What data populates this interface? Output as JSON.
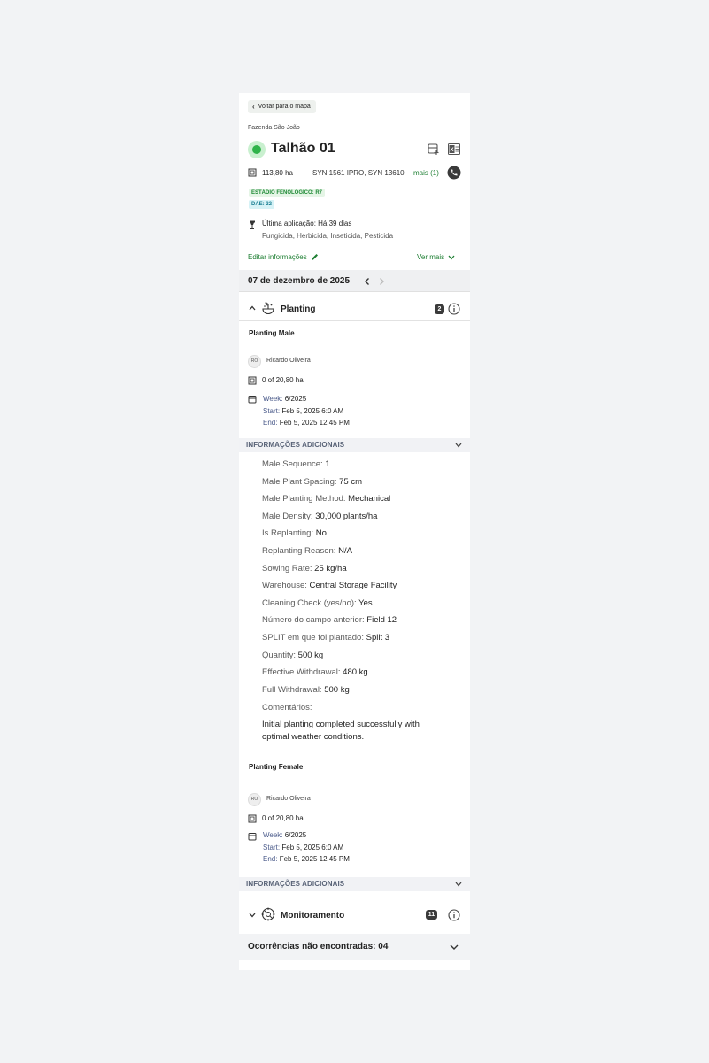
{
  "header": {
    "back_label": "Voltar para o mapa",
    "farm_name": "Fazenda São João",
    "field_name": "Talhão 01",
    "area": "113,80 ha",
    "varieties": "SYN 1561 IPRO, SYN 13610",
    "more_link": "mais (1)",
    "phenology_badge": "ESTÁDIO FENOLÓGICO: R7",
    "dae_badge": "DAE: 32",
    "last_application": "Última aplicação: Há 39 dias",
    "application_types": "Fungicida, Herbicida, Inseticida, Pesticida",
    "edit_link": "Editar informações",
    "see_more_link": "Ver mais"
  },
  "date_bar": {
    "date": "07 de dezembro de 2025"
  },
  "planting": {
    "title": "Planting",
    "count": "2",
    "male": {
      "title": "Planting Male",
      "avatar_initials": "RO",
      "person": "Ricardo Oliveira",
      "area": "0 of 20,80 ha",
      "week_label": "Week:",
      "week_value": "6/2025",
      "start_label": "Start:",
      "start_value": "Feb 5, 2025 6:0 AM",
      "end_label": "End:",
      "end_value": "Feb 5, 2025 12:45 PM",
      "additional_title": "INFORMAÇÕES ADICIONAIS",
      "details": [
        {
          "k": "Male Sequence:",
          "v": "1"
        },
        {
          "k": "Male Plant Spacing:",
          "v": "75 cm"
        },
        {
          "k": "Male Planting Method:",
          "v": "Mechanical"
        },
        {
          "k": "Male Density:",
          "v": "30,000 plants/ha"
        },
        {
          "k": "Is Replanting:",
          "v": "No"
        },
        {
          "k": "Replanting Reason:",
          "v": "N/A"
        },
        {
          "k": "Sowing Rate:",
          "v": "25 kg/ha"
        },
        {
          "k": "Warehouse:",
          "v": "Central Storage Facility"
        },
        {
          "k": "Cleaning Check (yes/no):",
          "v": "Yes"
        },
        {
          "k": "Número do campo anterior:",
          "v": "Field 12"
        },
        {
          "k": "SPLIT em que foi plantado:",
          "v": "Split 3"
        },
        {
          "k": "Quantity:",
          "v": "500 kg"
        },
        {
          "k": "Effective Withdrawal:",
          "v": "480 kg"
        },
        {
          "k": "Full Withdrawal:",
          "v": "500 kg"
        }
      ],
      "comments_label": "Comentários:",
      "comments_line1": "Initial planting completed successfully with",
      "comments_line2": "optimal weather conditions."
    },
    "female": {
      "title": "Planting Female",
      "avatar_initials": "RO",
      "person": "Ricardo Oliveira",
      "area": "0 of 20,80 ha",
      "week_label": "Week:",
      "week_value": "6/2025",
      "start_label": "Start:",
      "start_value": "Feb 5, 2025 6:0 AM",
      "end_label": "End:",
      "end_value": "Feb 5, 2025 12:45 PM",
      "additional_title": "INFORMAÇÕES ADICIONAIS"
    }
  },
  "monitoring": {
    "title": "Monitoramento",
    "count": "11"
  },
  "occurrences": {
    "title": "Ocorrências não encontradas: 04"
  },
  "colors": {
    "accent_green": "#1e7f33",
    "status_green": "#2fb34a",
    "badge_dark": "#3a3a3a"
  }
}
